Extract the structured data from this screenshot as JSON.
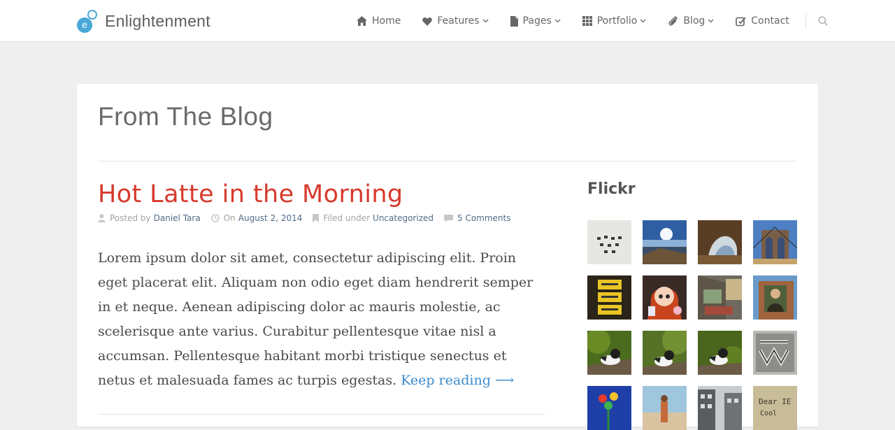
{
  "site": {
    "name": "Enlightenment",
    "logo_letter": "e"
  },
  "nav": {
    "items": [
      {
        "label": "Home",
        "icon": "home-icon",
        "dropdown": false
      },
      {
        "label": "Features",
        "icon": "heart-icon",
        "dropdown": true
      },
      {
        "label": "Pages",
        "icon": "file-icon",
        "dropdown": true
      },
      {
        "label": "Portfolio",
        "icon": "grid-icon",
        "dropdown": true
      },
      {
        "label": "Blog",
        "icon": "paperclip-icon",
        "dropdown": true
      },
      {
        "label": "Contact",
        "icon": "edit-icon",
        "dropdown": false
      }
    ],
    "search_icon": "search-icon"
  },
  "page": {
    "title": "From The Blog"
  },
  "post": {
    "title": "Hot Latte in the Morning",
    "meta": {
      "posted_by_label": "Posted by",
      "author": "Daniel Tara",
      "on_label": "On",
      "date": "August 2, 2014",
      "filed_label": "Filed under",
      "category": "Uncategorized",
      "comments": "5 Comments"
    },
    "excerpt": "Lorem ipsum dolor sit amet, consectetur adipiscing elit. Proin eget placerat elit. Aliquam non odio eget diam hendrerit semper in et neque. Aenean adipiscing dolor ac mauris molestie, ac scelerisque ante varius. Curabitur pellentesque vitae nisl a accumsan. Pellentesque habitant morbi tristique senectus et netus et malesuada fames ac turpis egestas.",
    "keep_reading": "Keep reading ⟶"
  },
  "sidebar": {
    "widget_title": "Flickr",
    "photos": [
      "flickr-photo-1",
      "flickr-photo-2",
      "flickr-photo-3",
      "flickr-photo-4",
      "flickr-photo-5",
      "flickr-photo-6",
      "flickr-photo-7",
      "flickr-photo-8",
      "flickr-photo-9",
      "flickr-photo-10",
      "flickr-photo-11",
      "flickr-photo-12",
      "flickr-photo-13",
      "flickr-photo-14",
      "flickr-photo-15",
      "flickr-photo-16"
    ],
    "photo_16_text": "Dear IE Cool"
  },
  "colors": {
    "accent_red": "#d63a2c",
    "link_blue": "#3e8bcb",
    "logo_blue": "#49a8d8",
    "meta_link": "#4f6c88"
  }
}
